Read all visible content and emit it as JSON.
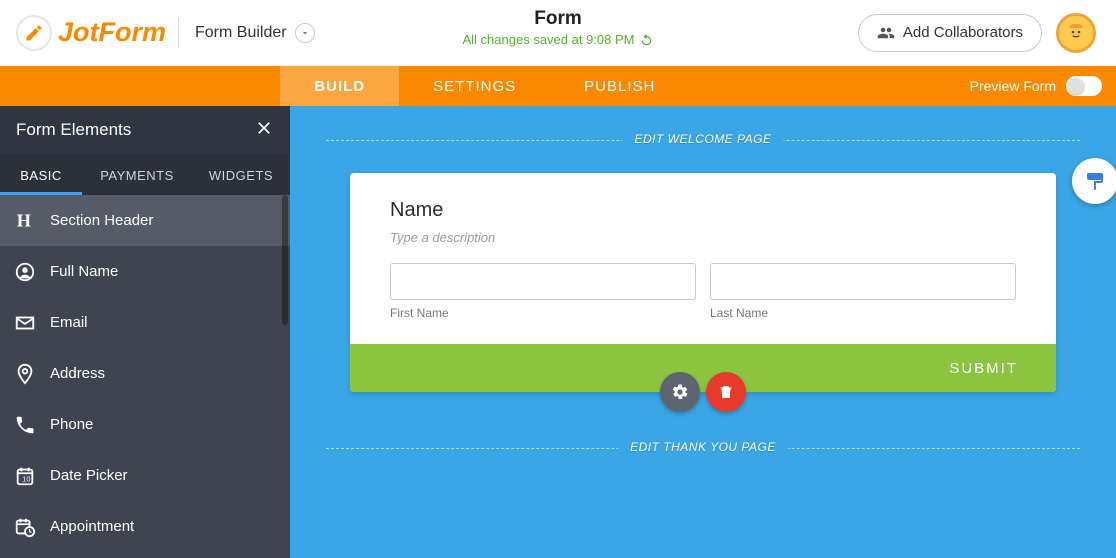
{
  "header": {
    "logo_text": "JotForm",
    "form_builder_label": "Form Builder",
    "form_title": "Form",
    "save_status": "All changes saved at 9:08 PM",
    "collab_label": "Add Collaborators"
  },
  "nav": {
    "tabs": [
      "BUILD",
      "SETTINGS",
      "PUBLISH"
    ],
    "active": "BUILD",
    "preview_label": "Preview Form",
    "preview_on": false
  },
  "sidebar": {
    "title": "Form Elements",
    "tabs": [
      "BASIC",
      "PAYMENTS",
      "WIDGETS"
    ],
    "active_tab": "BASIC",
    "elements": [
      {
        "icon": "header",
        "label": "Section Header",
        "selected": true
      },
      {
        "icon": "user",
        "label": "Full Name"
      },
      {
        "icon": "mail",
        "label": "Email"
      },
      {
        "icon": "pin",
        "label": "Address"
      },
      {
        "icon": "phone",
        "label": "Phone"
      },
      {
        "icon": "calendar",
        "label": "Date Picker"
      },
      {
        "icon": "calclock",
        "label": "Appointment"
      }
    ]
  },
  "canvas": {
    "welcome_label": "EDIT WELCOME PAGE",
    "thankyou_label": "EDIT THANK YOU PAGE",
    "field": {
      "title": "Name",
      "desc_placeholder": "Type a description",
      "first_label": "First Name",
      "last_label": "Last Name"
    },
    "submit_label": "SUBMIT"
  }
}
